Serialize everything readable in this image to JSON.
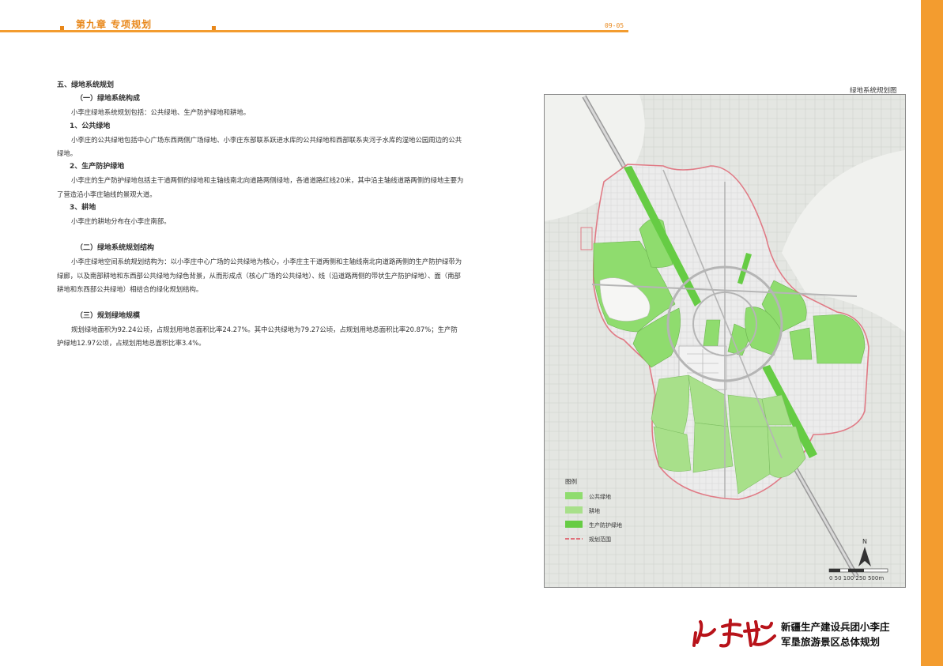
{
  "header": {
    "chapter_title": "第九章 专项规划",
    "page_number": "09-05"
  },
  "article": {
    "section_title": "五、绿地系统规划",
    "sub1_title": "（一）绿地系统构成",
    "sub1_intro": "小李庄绿地系统规划包括：公共绿地、生产防护绿地和耕地。",
    "item1_title": "1、公共绿地",
    "item1_text": "小李庄的公共绿地包括中心广场东西两侧广场绿地、小李庄东部联系跃进水库的公共绿地和西部联系夹河子水库的湿地公园周边的公共绿地。",
    "item2_title": "2、生产防护绿地",
    "item2_text": "小李庄的生产防护绿地包括主干道两侧的绿地和主轴线南北向道路两侧绿地，各道道路红线20米，其中沿主轴线道路两侧的绿地主要为了营造沿小李庄轴线的景观大道。",
    "item3_title": "3、耕地",
    "item3_text": "小李庄的耕地分布在小李庄南部。",
    "sub2_title": "（二）绿地系统规划结构",
    "sub2_text": "小李庄绿地空间系统规划结构为：以小李庄中心广场的公共绿地为核心，小李庄主干道两侧和主轴线南北向道路两侧的生产防护绿带为绿廊，以及南部耕地和东西部公共绿地为绿色背景，从而形成点（核心广场的公共绿地）、线（沿道路两侧的带状生产防护绿地）、面（南部耕地和东西部公共绿地）相结合的绿化规划结构。",
    "sub3_title": "（三）规划绿地规模",
    "sub3_text": "规划绿地面积为92.24公顷，占规划用地总面积比率24.27%。其中公共绿地为79.27公顷，占规划用地总面积比率20.87%；生产防护绿地12.97公顷，占规划用地总面积比率3.4%。"
  },
  "map": {
    "title": "绿地系统规划图",
    "legend_title": "图例",
    "legend_items": [
      {
        "label": "公共绿地",
        "color": "#8fdc6e"
      },
      {
        "label": "耕地",
        "color": "#a8e08a"
      },
      {
        "label": "生产防护绿地",
        "color": "#66cc44"
      },
      {
        "label": "规划范围",
        "color": "#e0707a"
      }
    ],
    "north_label": "N",
    "scale_label": "0 50 100  250     500m"
  },
  "footer": {
    "org_line1": "新疆生产建设兵团小李庄",
    "org_line2": "军垦旅游景区总体规划"
  },
  "colors": {
    "accent": "#f39c2f"
  }
}
